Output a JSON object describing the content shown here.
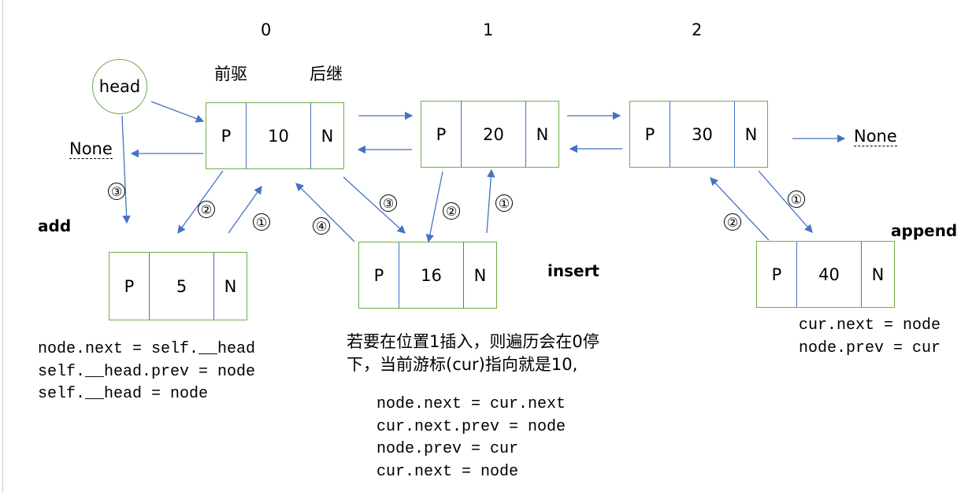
{
  "indices": [
    "0",
    "1",
    "2"
  ],
  "labels": {
    "prev": "前驱",
    "next": "后继",
    "head": "head",
    "none": "None",
    "add": "add",
    "insert": "insert",
    "append": "append"
  },
  "nodes": [
    {
      "p": "P",
      "v": "10",
      "n": "N"
    },
    {
      "p": "P",
      "v": "20",
      "n": "N"
    },
    {
      "p": "P",
      "v": "30",
      "n": "N"
    },
    {
      "p": "P",
      "v": "5",
      "n": "N"
    },
    {
      "p": "P",
      "v": "16",
      "n": "N"
    },
    {
      "p": "P",
      "v": "40",
      "n": "N"
    }
  ],
  "steps": {
    "one": "①",
    "two": "②",
    "three": "③",
    "four": "④"
  },
  "add_code": [
    "node.next = self.__head",
    "self.__head.prev = node",
    "self.__head = node"
  ],
  "insert_note": [
    "若要在位置1插入，则遍历会在0停",
    "下，当前游标(cur)指向就是10,"
  ],
  "insert_code": [
    "node.next = cur.next",
    "cur.next.prev = node",
    "node.prev = cur",
    "cur.next = node"
  ],
  "append_code": [
    "cur.next = node",
    "node.prev = cur"
  ],
  "colors": {
    "node_border": "#70ad47",
    "arrow": "#4472c4"
  }
}
